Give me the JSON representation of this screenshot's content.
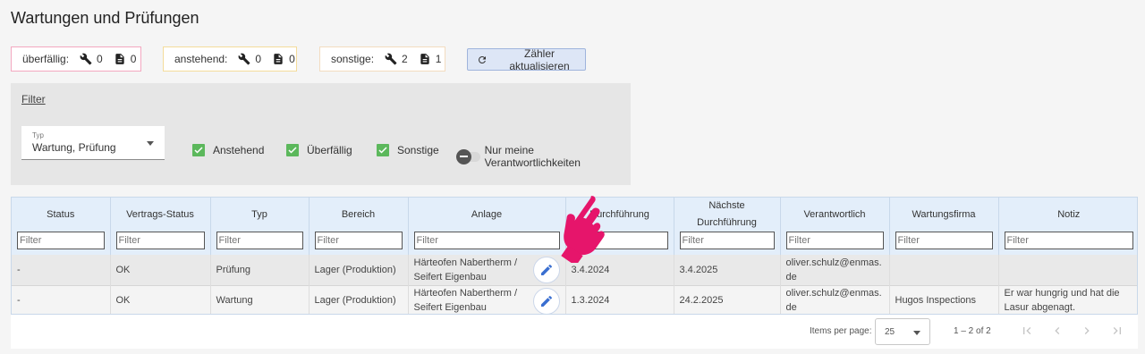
{
  "page": {
    "title": "Wartungen und Prüfungen"
  },
  "counters": {
    "overdue": {
      "label": "überfällig:",
      "wrench_count": "0",
      "doc_count": "0",
      "border_color": "#f3a8c0"
    },
    "pending": {
      "label": "anstehend:",
      "wrench_count": "0",
      "doc_count": "0",
      "border_color": "#f4dc9b"
    },
    "other": {
      "label": "sonstige:",
      "wrench_count": "2",
      "doc_count": "1",
      "border_color": "#f3dcc0"
    },
    "refresh_label": "Zähler aktualisieren"
  },
  "filter": {
    "link_label": "Filter",
    "type_select": {
      "label": "Typ",
      "value": "Wartung, Prüfung"
    },
    "checkboxes": [
      {
        "label": "Anstehend",
        "checked": true
      },
      {
        "label": "Überfällig",
        "checked": true
      },
      {
        "label": "Sonstige",
        "checked": true
      }
    ],
    "toggle": {
      "label": "Nur meine Verantwortlichkeiten",
      "on": false
    }
  },
  "table": {
    "filter_placeholder": "Filter",
    "columns": [
      "Status",
      "Vertrags-Status",
      "Typ",
      "Bereich",
      "Anlage",
      "Durchführung",
      "Nächste Durchführung",
      "Verantwortlich",
      "Wartungsfirma",
      "Notiz"
    ],
    "rows": [
      {
        "status": "-",
        "vertrags_status": "OK",
        "typ": "Prüfung",
        "bereich": "Lager (Produktion)",
        "anlage": "Härteofen Nabertherm / Seifert Eigenbau",
        "durchfuehrung": "3.4.2024",
        "naechste": "3.4.2025",
        "verantwortlich": "oliver.schulz@enmas.de",
        "wartungsfirma": "",
        "notiz": ""
      },
      {
        "status": "-",
        "vertrags_status": "OK",
        "typ": "Wartung",
        "bereich": "Lager (Produktion)",
        "anlage": "Härteofen Nabertherm / Seifert Eigenbau",
        "durchfuehrung": "1.3.2024",
        "naechste": "24.2.2025",
        "verantwortlich": "oliver.schulz@enmas.de",
        "wartungsfirma": "Hugos Inspections",
        "notiz": "Er war hungrig und hat die Lasur abgenagt."
      }
    ]
  },
  "paginator": {
    "items_per_page_label": "Items per page:",
    "page_size": "25",
    "range_label": "1 – 2 of 2"
  },
  "colors": {
    "accent": "#3a6fd0",
    "checkbox": "#5cb85c",
    "pointer": "#e6156b"
  },
  "icons": [
    "wrench-icon",
    "document-icon",
    "refresh-icon",
    "edit-icon",
    "first-page-icon",
    "prev-page-icon",
    "next-page-icon",
    "last-page-icon",
    "hand-pointer-icon"
  ]
}
